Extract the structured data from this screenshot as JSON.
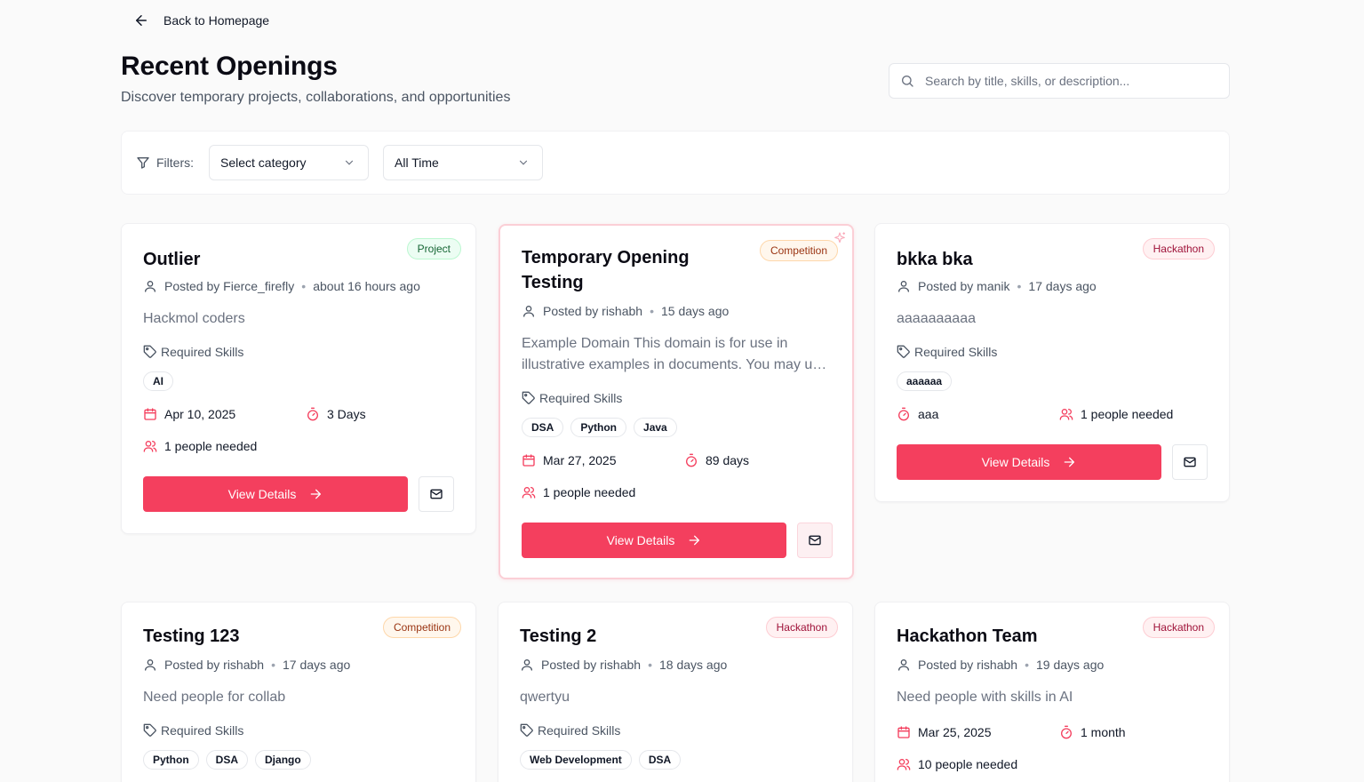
{
  "nav": {
    "back_label": "Back to Homepage"
  },
  "header": {
    "title": "Recent Openings",
    "subtitle": "Discover temporary projects, collaborations, and opportunities"
  },
  "search": {
    "placeholder": "Search by title, skills, or description...",
    "value": ""
  },
  "filters": {
    "label": "Filters:",
    "category": "Select category",
    "time": "All Time"
  },
  "common": {
    "required_skills": "Required Skills",
    "view_details": "View Details",
    "posted_by": "Posted by"
  },
  "colors": {
    "accent": "#f43f5e",
    "background": "#fafafa"
  },
  "cards": [
    {
      "title": "Outlier",
      "badge": "Project",
      "author": "Fierce_firefly",
      "posted": "about 16 hours ago",
      "description": "Hackmol coders",
      "skills": [
        "AI"
      ],
      "date": "Apr 10, 2025",
      "duration": "3 Days",
      "people": "1 people needed"
    },
    {
      "title": "Temporary Opening Testing",
      "badge": "Competition",
      "author": "rishabh",
      "posted": "15 days ago",
      "description": "Example Domain This domain is for use in illustrative examples in documents. You may use this domain in literature without prior coordination or asking for permission.",
      "skills": [
        "DSA",
        "Python",
        "Java"
      ],
      "date": "Mar 27, 2025",
      "duration": "89 days",
      "people": "1 people needed"
    },
    {
      "title": "bkka bka",
      "badge": "Hackathon",
      "author": "manik",
      "posted": "17 days ago",
      "description": "aaaaaaaaaa",
      "skills": [
        "aaaaaa"
      ],
      "duration": "aaa",
      "people": "1 people needed"
    },
    {
      "title": "Testing 123",
      "badge": "Competition",
      "author": "rishabh",
      "posted": "17 days ago",
      "description": "Need people for collab",
      "skills": [
        "Python",
        "DSA",
        "Django"
      ]
    },
    {
      "title": "Testing 2",
      "badge": "Hackathon",
      "author": "rishabh",
      "posted": "18 days ago",
      "description": "qwertyu",
      "skills": [
        "Web Development",
        "DSA"
      ]
    },
    {
      "title": "Hackathon Team",
      "badge": "Hackathon",
      "author": "rishabh",
      "posted": "19 days ago",
      "description": "Need people with skills in AI",
      "date": "Mar 25, 2025",
      "duration": "1 month",
      "people": "10 people needed"
    }
  ]
}
